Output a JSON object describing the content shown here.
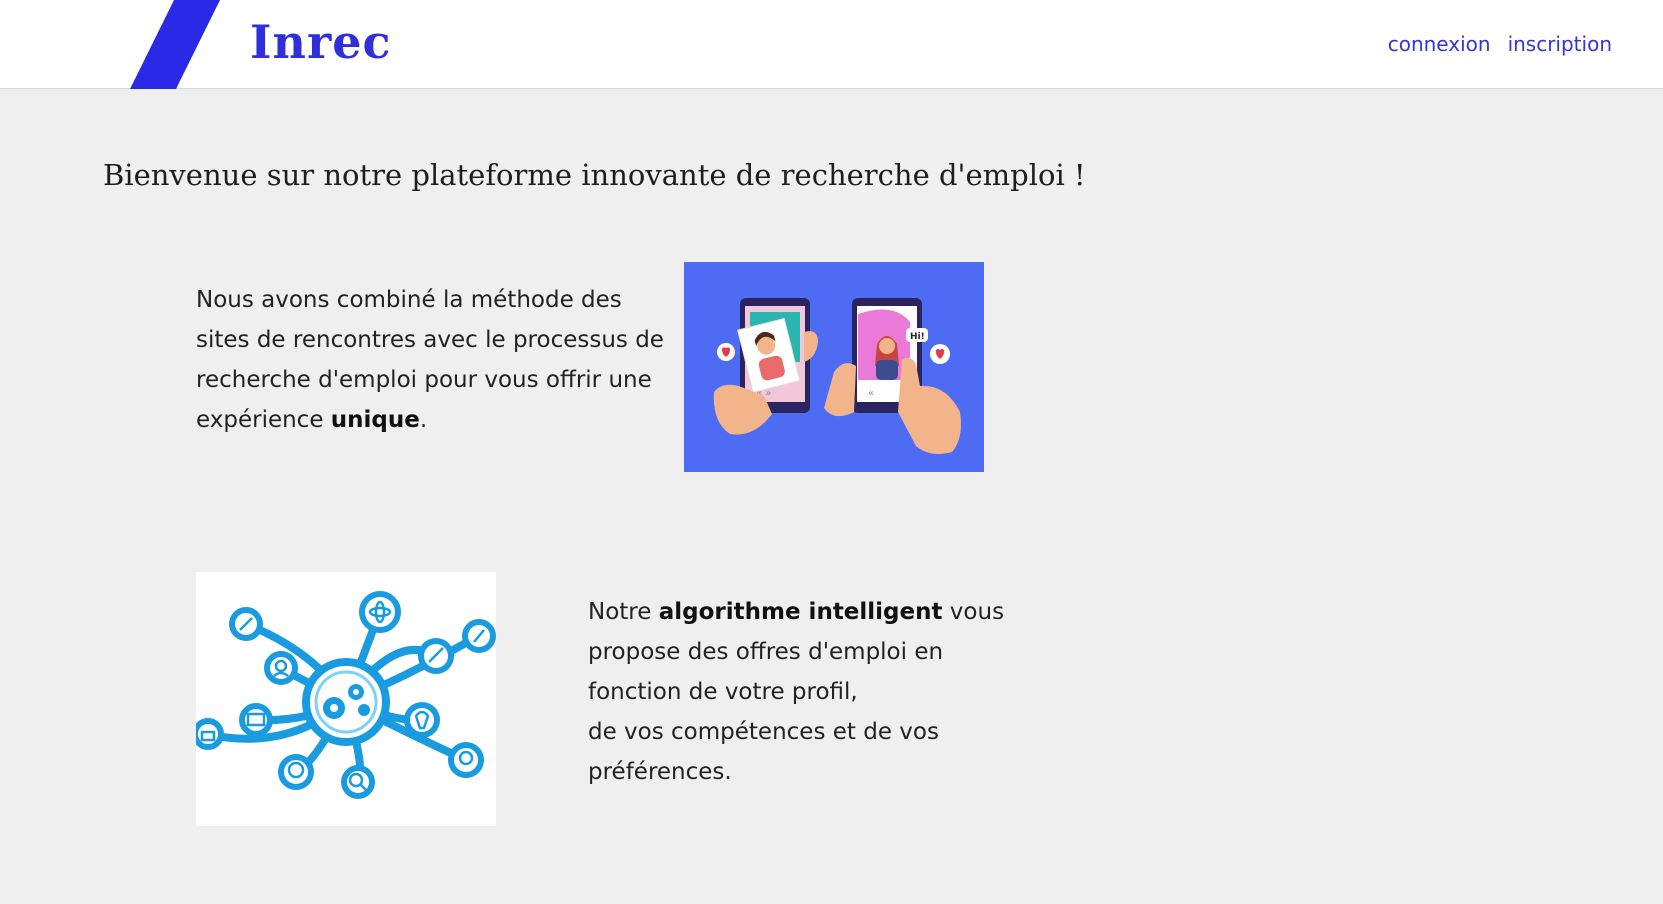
{
  "header": {
    "logo": "Inrec",
    "nav": {
      "login": "connexion",
      "signup": "inscription"
    }
  },
  "main": {
    "headline": "Bienvenue sur notre plateforme innovante de recherche d'emploi !",
    "section1": {
      "text_before": "Nous avons combiné la méthode des sites de rencontres avec le processus de recherche d'emploi pour vous offrir une expérience ",
      "text_bold": "unique",
      "text_after": ".",
      "image_icon": "dating-app-illustration",
      "image_badge": "Hi!"
    },
    "section2": {
      "text_before": "Notre ",
      "text_bold": "algorithme intelligent",
      "text_after": " vous propose des offres d'emploi en fonction de votre profil,",
      "text_line2": "de vos compétences et de vos préférences.",
      "image_icon": "network-gears-illustration"
    }
  },
  "colors": {
    "brand": "#2f2fdc",
    "link": "#3535d6",
    "background": "#efefef",
    "illustration_bg": "#4e6bf4",
    "network_blue": "#1a9be0"
  }
}
